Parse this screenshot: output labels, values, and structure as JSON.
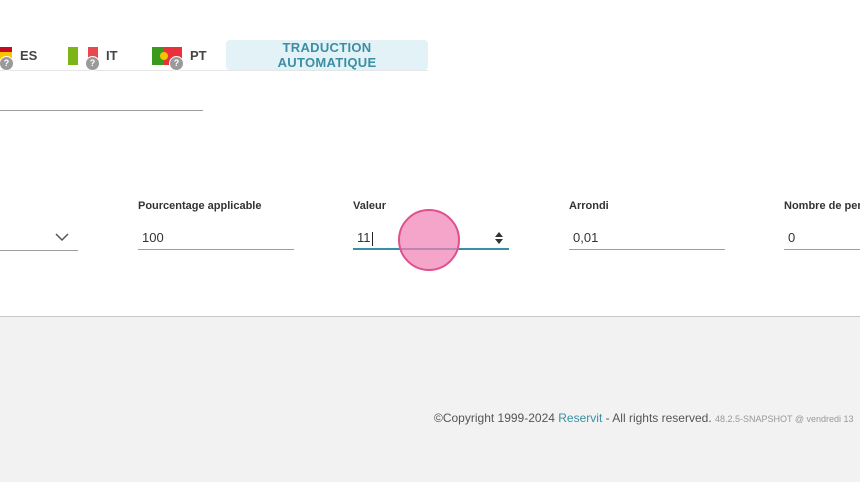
{
  "languages": [
    {
      "code": "ES",
      "flag_colors": [
        "#c60b1e",
        "#ffc400"
      ],
      "badge": "?"
    },
    {
      "code": "IT",
      "flag_colors": [
        "#009246",
        "#ffffff",
        "#ce2b37"
      ],
      "badge": "?"
    },
    {
      "code": "PT",
      "flag_colors": [
        "#006600",
        "#ff0000"
      ],
      "badge": "?"
    }
  ],
  "auto_translate_label": "TRADUCTION AUTOMATIQUE",
  "form": {
    "pourcentage": {
      "label": "Pourcentage applicable",
      "value": "100"
    },
    "valeur": {
      "label": "Valeur",
      "value": "11"
    },
    "arrondi": {
      "label": "Arrondi",
      "value": "0,01"
    },
    "nombre": {
      "label": "Nombre de pers",
      "value": "0"
    }
  },
  "footer": {
    "copyright_prefix": "©Copyright 1999-2024 ",
    "brand": "Reservit",
    "copyright_suffix": " - All rights reserved. ",
    "version": "48.2.5-SNAPSHOT @ vendredi 13"
  },
  "colors": {
    "accent": "#3a8fa4",
    "auto_btn_bg": "#e3f2f6",
    "click_marker": "#f08ab8"
  }
}
